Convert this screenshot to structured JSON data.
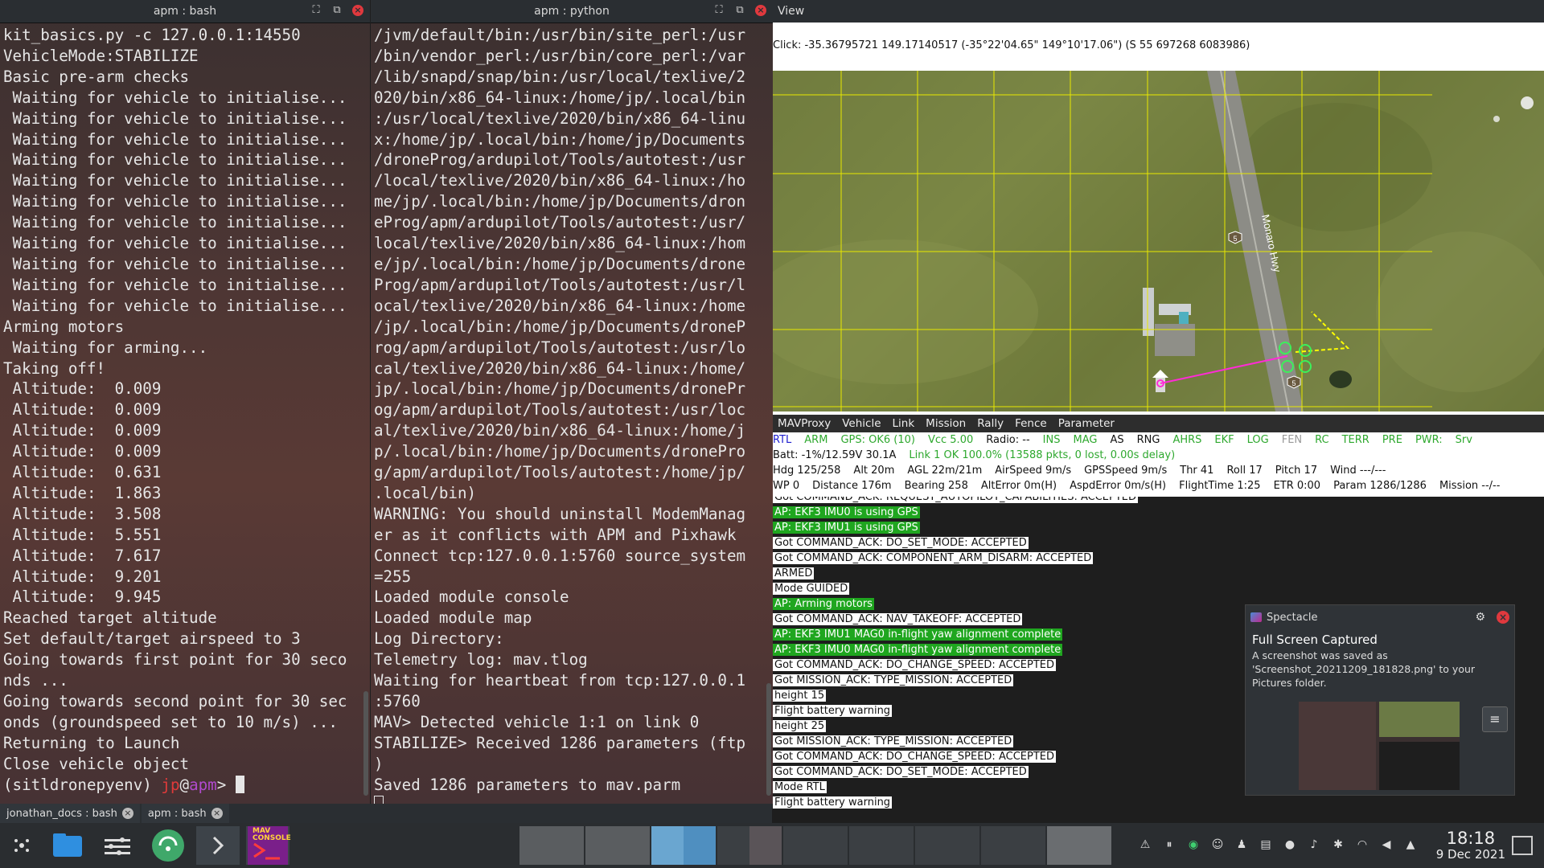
{
  "left_terminal": {
    "title": "apm : bash",
    "lines": [
      "kit_basics.py -c 127.0.0.1:14550",
      "VehicleMode:STABILIZE",
      "Basic pre-arm checks",
      " Waiting for vehicle to initialise...",
      " Waiting for vehicle to initialise...",
      " Waiting for vehicle to initialise...",
      " Waiting for vehicle to initialise...",
      " Waiting for vehicle to initialise...",
      " Waiting for vehicle to initialise...",
      " Waiting for vehicle to initialise...",
      " Waiting for vehicle to initialise...",
      " Waiting for vehicle to initialise...",
      " Waiting for vehicle to initialise...",
      " Waiting for vehicle to initialise...",
      "Arming motors",
      " Waiting for arming...",
      "Taking off!",
      " Altitude:  0.009",
      " Altitude:  0.009",
      " Altitude:  0.009",
      " Altitude:  0.009",
      " Altitude:  0.631",
      " Altitude:  1.863",
      " Altitude:  3.508",
      " Altitude:  5.551",
      " Altitude:  7.617",
      " Altitude:  9.201",
      " Altitude:  9.945",
      "Reached target altitude",
      "Set default/target airspeed to 3",
      "Going towards first point for 30 seco",
      "nds ...",
      "Going towards second point for 30 sec",
      "onds (groundspeed set to 10 m/s) ...",
      "Returning to Launch",
      "Close vehicle object"
    ],
    "prompt_env": "(sitldronepyenv) ",
    "prompt_user": "jp",
    "prompt_at": "@",
    "prompt_host": "apm",
    "prompt_end": "> "
  },
  "mid_terminal": {
    "title": "apm : python",
    "lines": [
      "/jvm/default/bin:/usr/bin/site_perl:/usr",
      "/bin/vendor_perl:/usr/bin/core_perl:/var",
      "/lib/snapd/snap/bin:/usr/local/texlive/2",
      "020/bin/x86_64-linux:/home/jp/.local/bin",
      ":/usr/local/texlive/2020/bin/x86_64-linu",
      "x:/home/jp/.local/bin:/home/jp/Documents",
      "/droneProg/ardupilot/Tools/autotest:/usr",
      "/local/texlive/2020/bin/x86_64-linux:/ho",
      "me/jp/.local/bin:/home/jp/Documents/dron",
      "eProg/apm/ardupilot/Tools/autotest:/usr/",
      "local/texlive/2020/bin/x86_64-linux:/hom",
      "e/jp/.local/bin:/home/jp/Documents/drone",
      "Prog/apm/ardupilot/Tools/autotest:/usr/l",
      "ocal/texlive/2020/bin/x86_64-linux:/home",
      "/jp/.local/bin:/home/jp/Documents/droneP",
      "rog/apm/ardupilot/Tools/autotest:/usr/lo",
      "cal/texlive/2020/bin/x86_64-linux:/home/",
      "jp/.local/bin:/home/jp/Documents/dronePr",
      "og/apm/ardupilot/Tools/autotest:/usr/loc",
      "al/texlive/2020/bin/x86_64-linux:/home/j",
      "p/.local/bin:/home/jp/Documents/dronePro",
      "g/apm/ardupilot/Tools/autotest:/home/jp/",
      ".local/bin)",
      "WARNING: You should uninstall ModemManag",
      "er as it conflicts with APM and Pixhawk",
      "Connect tcp:127.0.0.1:5760 source_system",
      "=255",
      "Loaded module console",
      "Loaded module map",
      "Log Directory:",
      "Telemetry log: mav.tlog",
      "Waiting for heartbeat from tcp:127.0.0.1",
      ":5760",
      "MAV> Detected vehicle 1:1 on link 0",
      "STABILIZE> Received 1286 parameters (ftp",
      ")",
      "Saved 1286 parameters to mav.parm"
    ]
  },
  "tabs": [
    {
      "label": "jonathan_docs : bash"
    },
    {
      "label": "apm : bash"
    }
  ],
  "view": {
    "title": "View",
    "click_text": "Click: -35.36795721 149.17140517 (-35°22'04.65\" 149°10'17.06\") (S 55 697268 6083986)",
    "road_label": "Monaro Hwy",
    "road_shield": "5"
  },
  "menubar": [
    "MAVProxy",
    "Vehicle",
    "Link",
    "Mission",
    "Rally",
    "Fence",
    "Parameter"
  ],
  "status": {
    "row1": [
      {
        "text": "RTL",
        "color": "b"
      },
      {
        "text": "ARM",
        "color": "g"
      },
      {
        "text": "GPS: OK6 (10)",
        "color": "g"
      },
      {
        "text": "Vcc 5.00",
        "color": "g"
      },
      {
        "text": "Radio: --",
        "color": ""
      },
      {
        "text": "INS",
        "color": "g"
      },
      {
        "text": "MAG",
        "color": "g"
      },
      {
        "text": "AS",
        "color": ""
      },
      {
        "text": "RNG",
        "color": ""
      },
      {
        "text": "AHRS",
        "color": "g"
      },
      {
        "text": "EKF",
        "color": "g"
      },
      {
        "text": "LOG",
        "color": "g"
      },
      {
        "text": "FEN",
        "color": "gy"
      },
      {
        "text": "RC",
        "color": "g"
      },
      {
        "text": "TERR",
        "color": "g"
      },
      {
        "text": "PRE",
        "color": "g"
      },
      {
        "text": "PWR:",
        "color": "g"
      },
      {
        "text": "Srv",
        "color": "g"
      }
    ],
    "row2": [
      {
        "text": "Batt: -1%/12.59V 30.1A",
        "color": ""
      },
      {
        "text": "Link 1 OK 100.0% (13588 pkts, 0 lost, 0.00s delay)",
        "color": "g"
      }
    ],
    "row3": [
      "Hdg 125/258",
      "Alt 20m",
      "AGL 22m/21m",
      "AirSpeed 9m/s",
      "GPSSpeed 9m/s",
      "Thr 41",
      "Roll 17",
      "Pitch 17",
      "Wind ---/---"
    ],
    "row4": [
      "WP 0",
      "Distance 176m",
      "Bearing 258",
      "AltError 0m(H)",
      "AspdError 0m/s(H)",
      "FlightTime 1:25",
      "ETR 0:00",
      "Param 1286/1286",
      "Mission --/--"
    ]
  },
  "console": [
    {
      "text": "Got COMMAND_ACK: REQUEST_AUTOPILOT_CAPABILITIES: ACCEPTED",
      "style": "w"
    },
    {
      "text": "AP: EKF3 IMU0 is using GPS",
      "style": "gr"
    },
    {
      "text": "AP: EKF3 IMU1 is using GPS",
      "style": "gr"
    },
    {
      "text": "Got COMMAND_ACK: DO_SET_MODE: ACCEPTED",
      "style": "w"
    },
    {
      "text": "Got COMMAND_ACK: COMPONENT_ARM_DISARM: ACCEPTED",
      "style": "w"
    },
    {
      "text": "ARMED",
      "style": "w"
    },
    {
      "text": "Mode GUIDED",
      "style": "w"
    },
    {
      "text": "AP: Arming motors",
      "style": "gr"
    },
    {
      "text": "Got COMMAND_ACK: NAV_TAKEOFF: ACCEPTED",
      "style": "w"
    },
    {
      "text": "AP: EKF3 IMU1 MAG0 in-flight yaw alignment complete",
      "style": "gr"
    },
    {
      "text": "AP: EKF3 IMU0 MAG0 in-flight yaw alignment complete",
      "style": "gr"
    },
    {
      "text": "Got COMMAND_ACK: DO_CHANGE_SPEED: ACCEPTED",
      "style": "w"
    },
    {
      "text": "Got MISSION_ACK: TYPE_MISSION: ACCEPTED",
      "style": "w"
    },
    {
      "text": "height 15",
      "style": "w"
    },
    {
      "text": "Flight battery warning",
      "style": "w"
    },
    {
      "text": "height 25",
      "style": "w"
    },
    {
      "text": "Got MISSION_ACK: TYPE_MISSION: ACCEPTED",
      "style": "w"
    },
    {
      "text": "Got COMMAND_ACK: DO_CHANGE_SPEED: ACCEPTED",
      "style": "w"
    },
    {
      "text": "Got COMMAND_ACK: DO_SET_MODE: ACCEPTED",
      "style": "w"
    },
    {
      "text": "Mode RTL",
      "style": "w"
    },
    {
      "text": "Flight battery warning",
      "style": "w"
    }
  ],
  "spectacle": {
    "app": "Spectacle",
    "title": "Full Screen Captured",
    "message": "A screenshot was saved as 'Screenshot_20211209_181828.png' to your Pictures folder."
  },
  "taskbar": {
    "time": "18:18",
    "date": "9 Dec 2021",
    "mav_icon_text": "MAV CONSOLE"
  }
}
